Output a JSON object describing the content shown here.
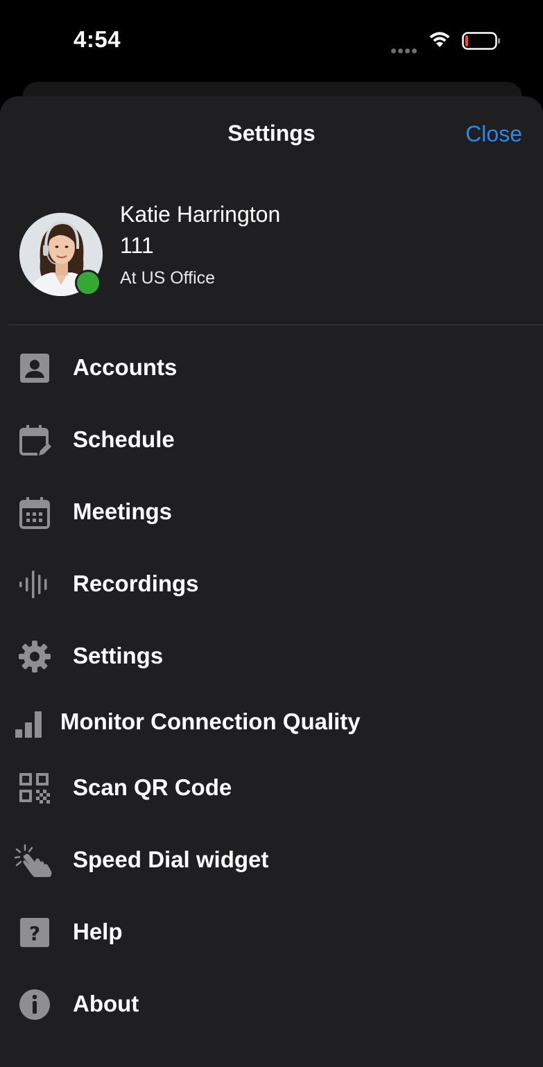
{
  "status_bar": {
    "time": "4:54"
  },
  "header": {
    "title": "Settings",
    "close_label": "Close"
  },
  "profile": {
    "name": "Katie Harrington",
    "extension": "111",
    "location": "At US Office",
    "presence_color": "#34a835"
  },
  "menu": [
    {
      "label": "Accounts",
      "icon": "account-box-icon"
    },
    {
      "label": "Schedule",
      "icon": "calendar-edit-icon"
    },
    {
      "label": "Meetings",
      "icon": "calendar-grid-icon"
    },
    {
      "label": "Recordings",
      "icon": "audio-waveform-icon"
    },
    {
      "label": "Settings",
      "icon": "gear-icon"
    },
    {
      "label": "Monitor Connection Quality",
      "icon": "signal-bars-icon"
    },
    {
      "label": "Scan QR Code",
      "icon": "qr-code-icon"
    },
    {
      "label": "Speed Dial widget",
      "icon": "tap-hand-icon"
    },
    {
      "label": "Help",
      "icon": "help-icon"
    },
    {
      "label": "About",
      "icon": "info-icon"
    }
  ],
  "colors": {
    "background": "#000000",
    "sheet": "#1f1f21",
    "accent": "#2e86e6",
    "icon": "#8e8e93"
  }
}
